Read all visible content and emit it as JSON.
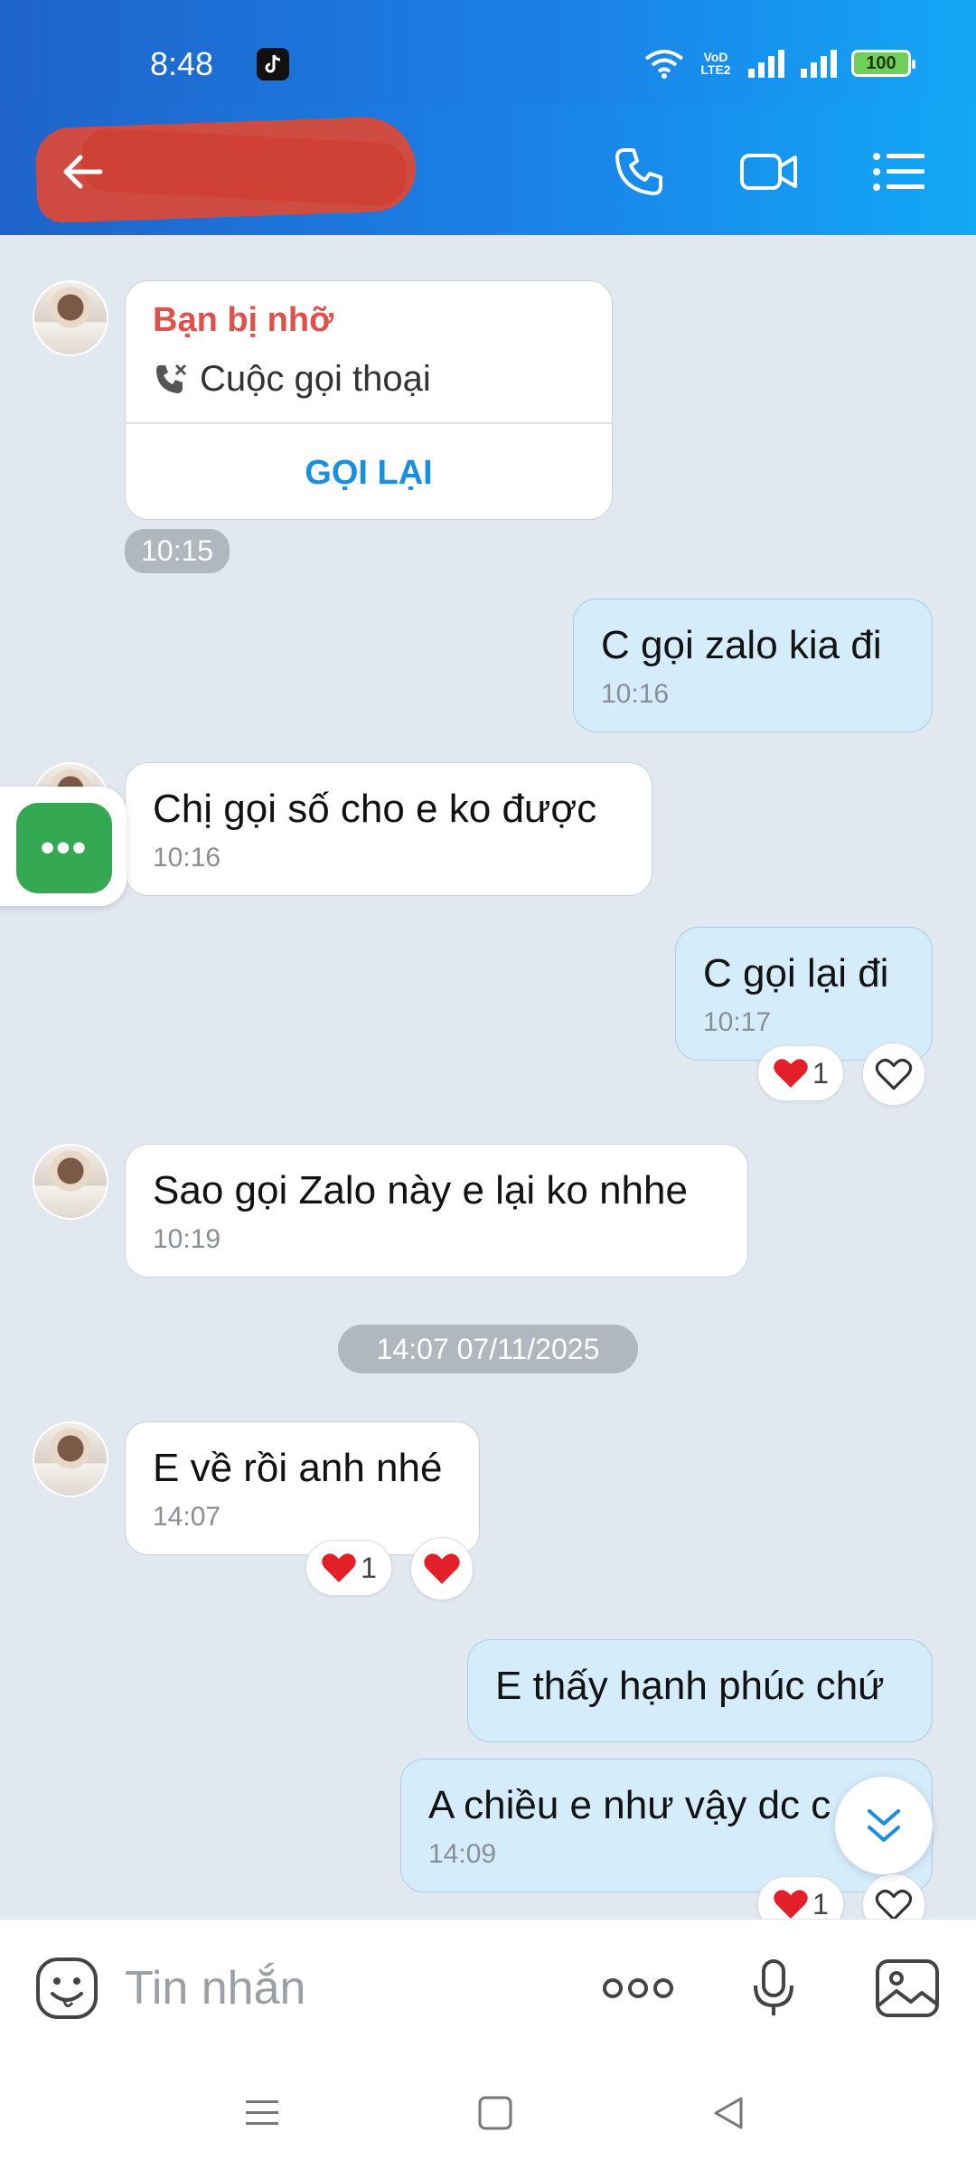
{
  "status_bar": {
    "time": "8:48",
    "battery": "100",
    "network_label": "VoD LTE2"
  },
  "header": {
    "contact_name": "",
    "back_label": "",
    "call_label": "",
    "video_label": "",
    "menu_label": ""
  },
  "colors": {
    "header_start": "#1f63c9",
    "header_end": "#14a7f5",
    "missed": "#e0514b",
    "link": "#1a8fe0",
    "outgoing_bubble": "#d5ecfb",
    "chat_bg": "#e2e8ef"
  },
  "missed_call": {
    "title": "Bạn bị nhỡ",
    "subtitle": "Cuộc gọi thoại",
    "action": "GỌI LẠI",
    "time": "10:15"
  },
  "messages": [
    {
      "direction": "out",
      "text": "C gọi zalo kia đi",
      "time": "10:16"
    },
    {
      "direction": "in",
      "text": "Chị gọi số cho e ko được",
      "time": "10:16"
    },
    {
      "direction": "out",
      "text": "C gọi lại đi",
      "time": "10:17",
      "reaction_count": "1"
    },
    {
      "direction": "in",
      "text": "Sao gọi Zalo này e lại ko nhhe",
      "time": "10:19"
    },
    {
      "direction": "in",
      "text": "E về rồi anh nhé",
      "time": "14:07",
      "reaction_count": "1"
    },
    {
      "direction": "out",
      "text": "E thấy hạnh phúc chứ",
      "time": ""
    },
    {
      "direction": "out",
      "text": "A chiều e như vậy dc c",
      "time": "14:09",
      "reaction_count": "1"
    }
  ],
  "date_separator": "14:07 07/11/2025",
  "floating_menu": {
    "label": "•••"
  },
  "input": {
    "placeholder": "Tin nhắn"
  },
  "icons": [
    "back-arrow-icon",
    "phone-icon",
    "video-icon",
    "menu-list-icon",
    "missed-call-icon",
    "heart-icon",
    "heart-outline-icon",
    "chevron-double-down-icon",
    "emoji-sticker-icon",
    "more-dots-icon",
    "microphone-icon",
    "image-icon"
  ]
}
